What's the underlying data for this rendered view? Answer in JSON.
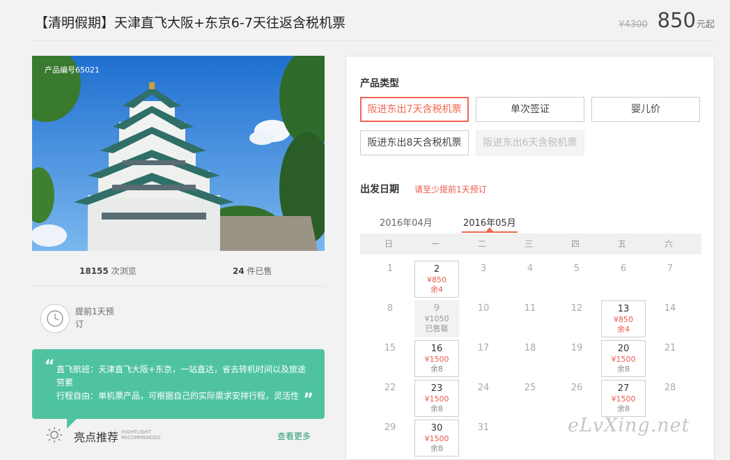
{
  "header": {
    "title": "【清明假期】天津直飞大阪+东京6-7天往返含税机票",
    "old_price": "¥4300",
    "price": "850",
    "price_unit": "元起"
  },
  "product": {
    "code_label": "产品编号65021",
    "views_count": "18155",
    "views_label": "次浏览",
    "sold_count": "24",
    "sold_label": "件已售",
    "advance_text": "提前1天预订"
  },
  "highlights": {
    "quote_open": "“",
    "quote_close": "”",
    "line1": "直飞航班：天津直飞大阪+东京，一站直达，省去转机时间以及旅途劳累",
    "line2": "行程自由：单机票产品，可根据自己的实际需求安排行程，灵活性",
    "title": "亮点推荐",
    "sub1": "HIGHTLIGHT",
    "sub2": "RECOMMENDED",
    "more": "查看更多"
  },
  "booking": {
    "type_label": "产品类型",
    "options": [
      {
        "label": "阪进东出7天含税机票",
        "state": "active"
      },
      {
        "label": "单次签证",
        "state": "normal"
      },
      {
        "label": "婴儿价",
        "state": "normal"
      },
      {
        "label": "阪进东出8天含税机票",
        "state": "normal"
      },
      {
        "label": "阪进东出6天含税机票",
        "state": "disabled"
      }
    ],
    "date_label": "出发日期",
    "date_hint": "请至少提前1天预订",
    "months": [
      "2016年04月",
      "2016年05月"
    ],
    "active_month": 1,
    "weekdays": [
      "日",
      "一",
      "二",
      "三",
      "四",
      "五",
      "六"
    ],
    "days": [
      {
        "d": "1"
      },
      {
        "d": "2",
        "price": "¥850",
        "stock": "余4",
        "state": "avail"
      },
      {
        "d": "3"
      },
      {
        "d": "4"
      },
      {
        "d": "5"
      },
      {
        "d": "6"
      },
      {
        "d": "7"
      },
      {
        "d": "8"
      },
      {
        "d": "9",
        "price": "¥1050",
        "stock": "已售罄",
        "state": "soldout"
      },
      {
        "d": "10"
      },
      {
        "d": "11"
      },
      {
        "d": "12"
      },
      {
        "d": "13",
        "price": "¥850",
        "stock": "余4",
        "state": "avail"
      },
      {
        "d": "14"
      },
      {
        "d": "15"
      },
      {
        "d": "16",
        "price": "¥1500",
        "stock": "余8",
        "state": "avail",
        "stock_gray": true
      },
      {
        "d": "17"
      },
      {
        "d": "18"
      },
      {
        "d": "19"
      },
      {
        "d": "20",
        "price": "¥1500",
        "stock": "余8",
        "state": "avail",
        "stock_gray": true
      },
      {
        "d": "21"
      },
      {
        "d": "22"
      },
      {
        "d": "23",
        "price": "¥1500",
        "stock": "余8",
        "state": "avail",
        "stock_gray": true
      },
      {
        "d": "24"
      },
      {
        "d": "25"
      },
      {
        "d": "26"
      },
      {
        "d": "27",
        "price": "¥1500",
        "stock": "余8",
        "state": "avail",
        "stock_gray": true
      },
      {
        "d": "28"
      },
      {
        "d": "29"
      },
      {
        "d": "30",
        "price": "¥1500",
        "stock": "余8",
        "state": "avail",
        "stock_gray": true
      },
      {
        "d": "31"
      }
    ]
  },
  "watermark": "eLvXing.net",
  "colors": {
    "accent": "#f06650",
    "green": "#4fc3a1",
    "link": "#2a9c78"
  }
}
